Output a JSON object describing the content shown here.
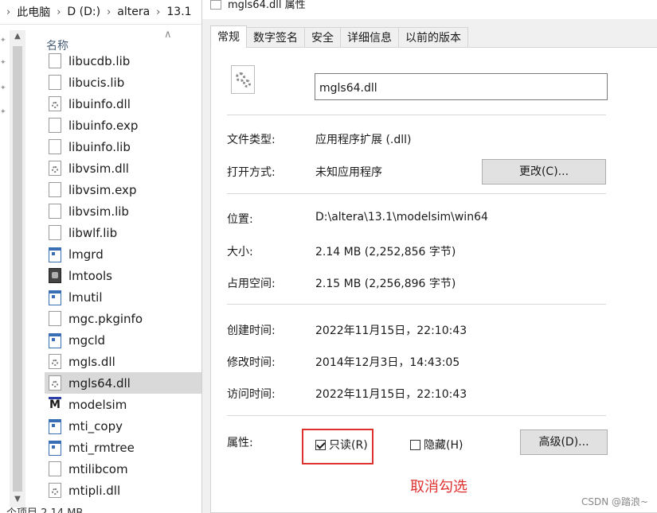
{
  "explorer": {
    "breadcrumb": [
      "此电脑",
      "D (D:)",
      "altera",
      "13.1"
    ],
    "column_header": "名称",
    "files": [
      {
        "name": "libucdb.lib",
        "icon": "document-icon"
      },
      {
        "name": "libucis.lib",
        "icon": "document-icon"
      },
      {
        "name": "libuinfo.dll",
        "icon": "dll-gear-icon"
      },
      {
        "name": "libuinfo.exp",
        "icon": "document-icon"
      },
      {
        "name": "libuinfo.lib",
        "icon": "document-icon"
      },
      {
        "name": "libvsim.dll",
        "icon": "dll-gear-icon"
      },
      {
        "name": "libvsim.exp",
        "icon": "document-icon"
      },
      {
        "name": "libvsim.lib",
        "icon": "document-icon"
      },
      {
        "name": "libwlf.lib",
        "icon": "document-icon"
      },
      {
        "name": "lmgrd",
        "icon": "window-app-icon"
      },
      {
        "name": "lmtools",
        "icon": "tools-app-icon"
      },
      {
        "name": "lmutil",
        "icon": "window-app-icon"
      },
      {
        "name": "mgc.pkginfo",
        "icon": "document-icon"
      },
      {
        "name": "mgcld",
        "icon": "window-app-icon"
      },
      {
        "name": "mgls.dll",
        "icon": "dll-gear-icon"
      },
      {
        "name": "mgls64.dll",
        "icon": "dll-gear-icon",
        "selected": true
      },
      {
        "name": "modelsim",
        "icon": "modelsim-app-icon"
      },
      {
        "name": "mti_copy",
        "icon": "window-app-icon"
      },
      {
        "name": "mti_rmtree",
        "icon": "window-app-icon"
      },
      {
        "name": "mtilibcom",
        "icon": "document-icon"
      },
      {
        "name": "mtipli.dll",
        "icon": "dll-gear-icon"
      }
    ],
    "status": "个项目  2.14 MB"
  },
  "props": {
    "title": "mgls64.dll 属性",
    "tabs": [
      "常规",
      "数字签名",
      "安全",
      "详细信息",
      "以前的版本"
    ],
    "active_tab": 0,
    "filename": "mgls64.dll",
    "file_type_label": "文件类型:",
    "file_type_value": "应用程序扩展 (.dll)",
    "open_with_label": "打开方式:",
    "open_with_value": "未知应用程序",
    "change_button": "更改(C)...",
    "location_label": "位置:",
    "location_value": "D:\\altera\\13.1\\modelsim\\win64",
    "size_label": "大小:",
    "size_value": "2.14 MB (2,252,856 字节)",
    "disk_size_label": "占用空间:",
    "disk_size_value": "2.15 MB (2,256,896 字节)",
    "created_label": "创建时间:",
    "created_value": "2022年11月15日，22:10:43",
    "modified_label": "修改时间:",
    "modified_value": "2014年12月3日，14:43:05",
    "accessed_label": "访问时间:",
    "accessed_value": "2022年11月15日，22:10:43",
    "attributes_label": "属性:",
    "readonly_label": "只读(R)",
    "readonly_checked": true,
    "hidden_label": "隐藏(H)",
    "hidden_checked": false,
    "advanced_button": "高级(D)...",
    "annotation": "取消勾选",
    "watermark": "CSDN @踏浪~"
  },
  "colors": {
    "annotation": "#e03131",
    "selected_row": "#d9d9d9"
  }
}
